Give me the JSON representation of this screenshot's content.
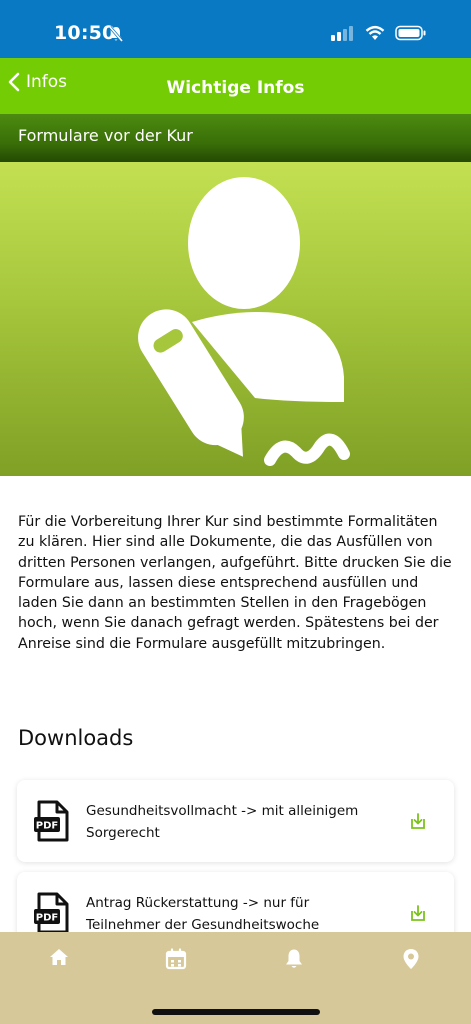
{
  "status_bar": {
    "time": "10:50"
  },
  "nav": {
    "back_label": "Infos",
    "title": "Wichtige Infos"
  },
  "section": {
    "title": "Formulare vor der Kur"
  },
  "intro": {
    "text": "Für die Vorbereitung Ihrer Kur sind bestimmte Formalitäten zu klären. Hier sind alle Dokumente, die das Ausfüllen von dritten Personen verlangen, aufgeführt. Bitte drucken Sie die Formulare aus, lassen diese entsprechend ausfüllen und laden Sie dann an bestimmten Stellen in den Fragebögen hoch, wenn Sie danach gefragt werden. Spätestens bei der Anreise sind die Formulare ausgefüllt mitzubringen."
  },
  "downloads": {
    "heading": "Downloads",
    "items": [
      {
        "label": "Gesundheitsvollmacht -> mit alleinigem Sorgerecht",
        "icon": "pdf-file-icon"
      },
      {
        "label": "Antrag Rückerstattung -> nur für Teilnehmer der Gesundheitswoche",
        "icon": "pdf-file-icon"
      }
    ]
  },
  "tab_bar": {
    "tabs": [
      "home-icon",
      "calendar-icon",
      "bell-icon",
      "location-pin-icon"
    ]
  },
  "colors": {
    "status_bar": "#0a79c4",
    "nav_bar": "#74cc05",
    "accent": "#7dc21e",
    "tab_bar": "#d6c898"
  }
}
